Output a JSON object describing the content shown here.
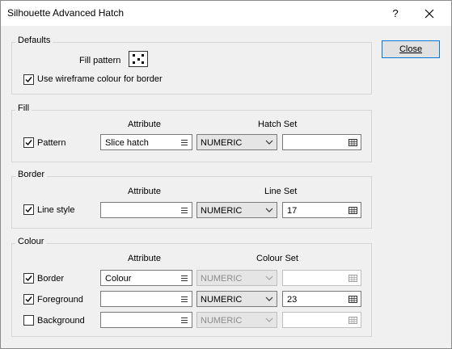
{
  "window": {
    "title": "Silhouette Advanced Hatch",
    "help_label": "?",
    "close_icon": "close-icon"
  },
  "close_button": {
    "label": "Close"
  },
  "defaults": {
    "group_label": "Defaults",
    "fill_pattern_label": "Fill pattern",
    "wireframe_label": "Use wireframe colour for border",
    "wireframe_checked": true
  },
  "fill": {
    "group_label": "Fill",
    "col_attribute": "Attribute",
    "col_set": "Hatch Set",
    "row": {
      "label": "Pattern",
      "checked": true,
      "attribute": "Slice hatch",
      "type": "NUMERIC",
      "set_value": ""
    }
  },
  "border": {
    "group_label": "Border",
    "col_attribute": "Attribute",
    "col_set": "Line Set",
    "row": {
      "label": "Line style",
      "checked": true,
      "attribute": "",
      "type": "NUMERIC",
      "set_value": "17"
    }
  },
  "colour": {
    "group_label": "Colour",
    "col_attribute": "Attribute",
    "col_set": "Colour Set",
    "rows": [
      {
        "label": "Border",
        "checked": true,
        "attribute": "Colour",
        "type": "NUMERIC",
        "set_value": "",
        "type_enabled": false
      },
      {
        "label": "Foreground",
        "checked": true,
        "attribute": "",
        "type": "NUMERIC",
        "set_value": "23",
        "type_enabled": true
      },
      {
        "label": "Background",
        "checked": false,
        "attribute": "",
        "type": "NUMERIC",
        "set_value": "",
        "type_enabled": false
      }
    ]
  }
}
